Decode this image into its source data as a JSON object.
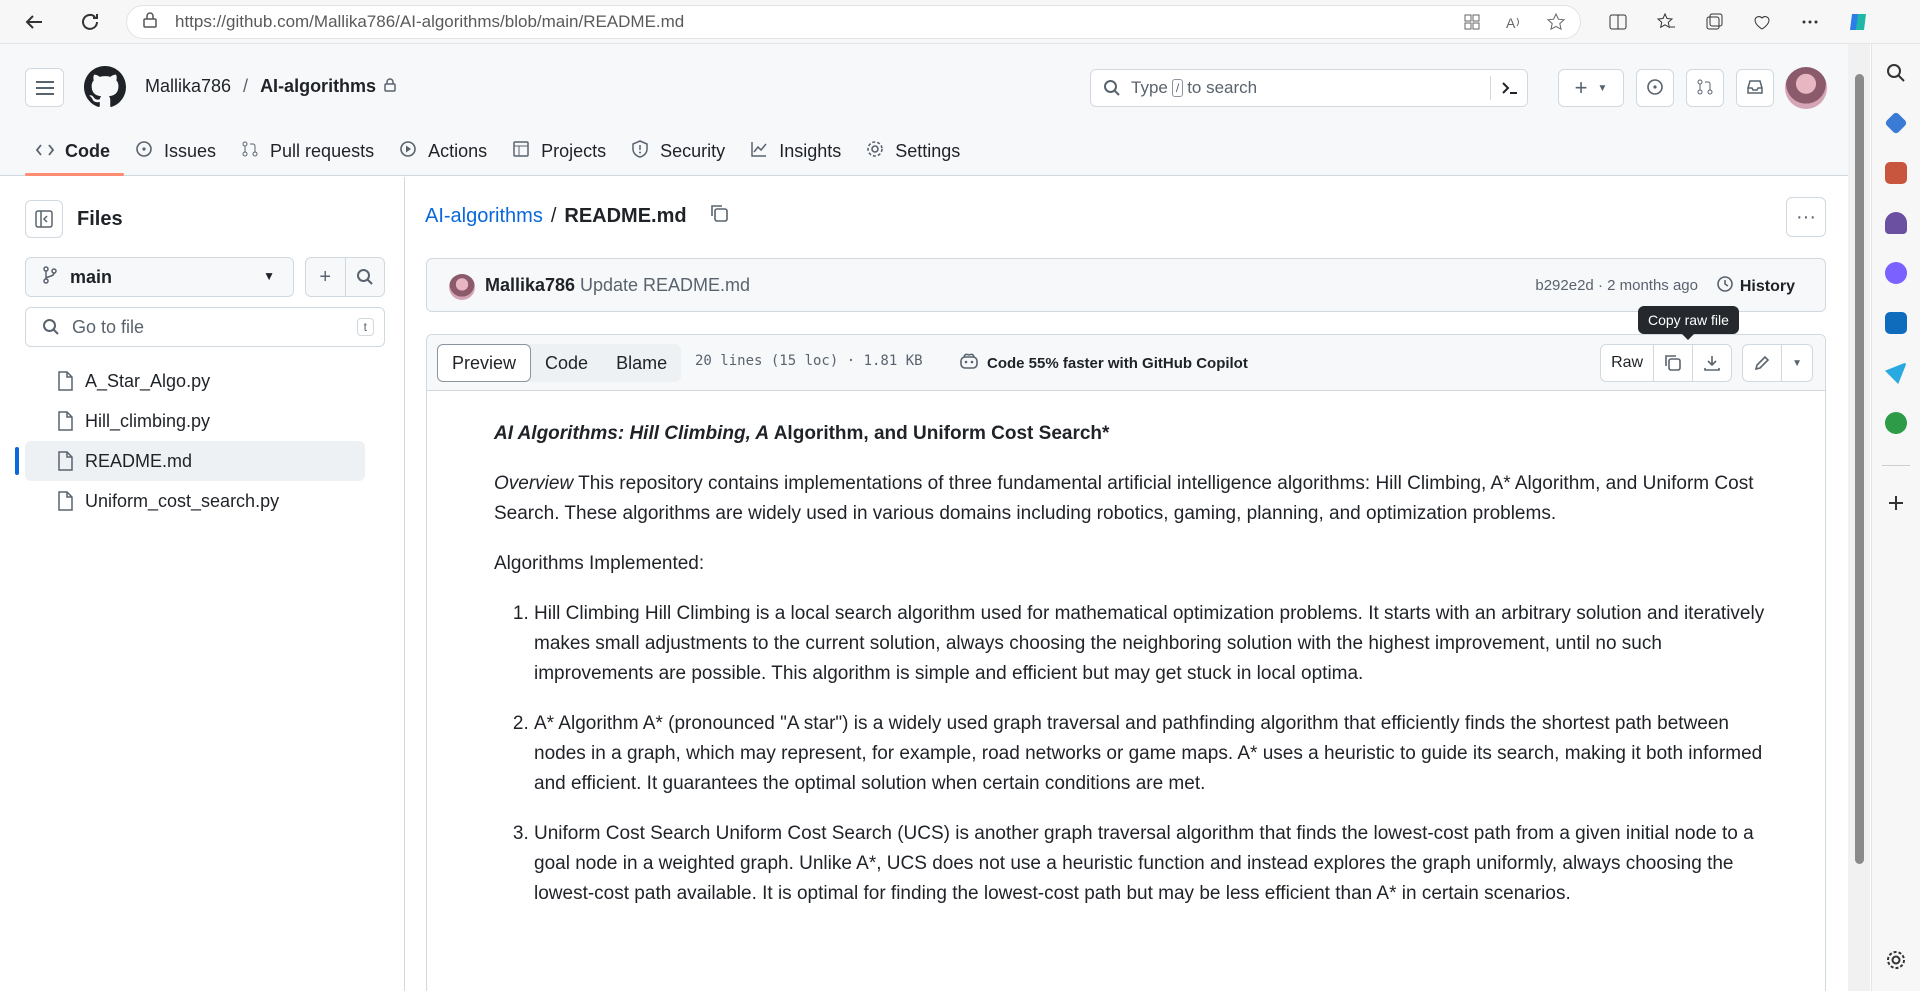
{
  "browser": {
    "url": "https://github.com/Mallika786/AI-algorithms/blob/main/README.md"
  },
  "header": {
    "owner": "Mallika786",
    "repo": "AI-algorithms",
    "search_placeholder_pre": "Type",
    "search_key": "/",
    "search_placeholder_post": "to search"
  },
  "tabs": [
    {
      "label": "Code",
      "icon": "code-icon"
    },
    {
      "label": "Issues",
      "icon": "issue-icon"
    },
    {
      "label": "Pull requests",
      "icon": "pull-request-icon"
    },
    {
      "label": "Actions",
      "icon": "play-icon"
    },
    {
      "label": "Projects",
      "icon": "table-icon"
    },
    {
      "label": "Security",
      "icon": "shield-icon"
    },
    {
      "label": "Insights",
      "icon": "graph-icon"
    },
    {
      "label": "Settings",
      "icon": "gear-icon"
    }
  ],
  "sidebar": {
    "title": "Files",
    "branch": "main",
    "goto_placeholder": "Go to file",
    "goto_key": "t",
    "files": [
      {
        "name": "A_Star_Algo.py"
      },
      {
        "name": "Hill_climbing.py"
      },
      {
        "name": "README.md"
      },
      {
        "name": "Uniform_cost_search.py"
      }
    ]
  },
  "file": {
    "repo_link": "AI-algorithms",
    "sep": "/",
    "name": "README.md"
  },
  "commit": {
    "author": "Mallika786",
    "message": "Update README.md",
    "sha_time": "b292e2d · 2 months ago",
    "history": "History"
  },
  "tooltip": "Copy raw file",
  "viewer": {
    "tabs": [
      "Preview",
      "Code",
      "Blame"
    ],
    "meta": "20 lines (15 loc) · 1.81 KB",
    "copilot": "Code 55% faster with GitHub Copilot",
    "raw": "Raw"
  },
  "readme": {
    "title_italic": "AI Algorithms: Hill Climbing, A",
    "title_rest": " Algorithm, and Uniform Cost Search*",
    "overview_italic": "Overview",
    "overview_rest": " This repository contains implementations of three fundamental artificial intelligence algorithms: Hill Climbing, A* Algorithm, and Uniform Cost Search. These algorithms are widely used in various domains including robotics, gaming, planning, and optimization problems.",
    "implemented": "Algorithms Implemented:",
    "items": [
      "Hill Climbing Hill Climbing is a local search algorithm used for mathematical optimization problems. It starts with an arbitrary solution and iteratively makes small adjustments to the current solution, always choosing the neighboring solution with the highest improvement, until no such improvements are possible. This algorithm is simple and efficient but may get stuck in local optima.",
      "A* Algorithm A* (pronounced \"A star\") is a widely used graph traversal and pathfinding algorithm that efficiently finds the shortest path between nodes in a graph, which may represent, for example, road networks or game maps. A* uses a heuristic to guide its search, making it both informed and efficient. It guarantees the optimal solution when certain conditions are met.",
      "Uniform Cost Search Uniform Cost Search (UCS) is another graph traversal algorithm that finds the lowest-cost path from a given initial node to a goal node in a weighted graph. Unlike A*, UCS does not use a heuristic function and instead explores the graph uniformly, always choosing the lowest-cost path available. It is optimal for finding the lowest-cost path but may be less efficient than A* in certain scenarios."
    ]
  },
  "colors": {
    "accent": "#0969da",
    "tab_underline": "#fd8c73"
  }
}
